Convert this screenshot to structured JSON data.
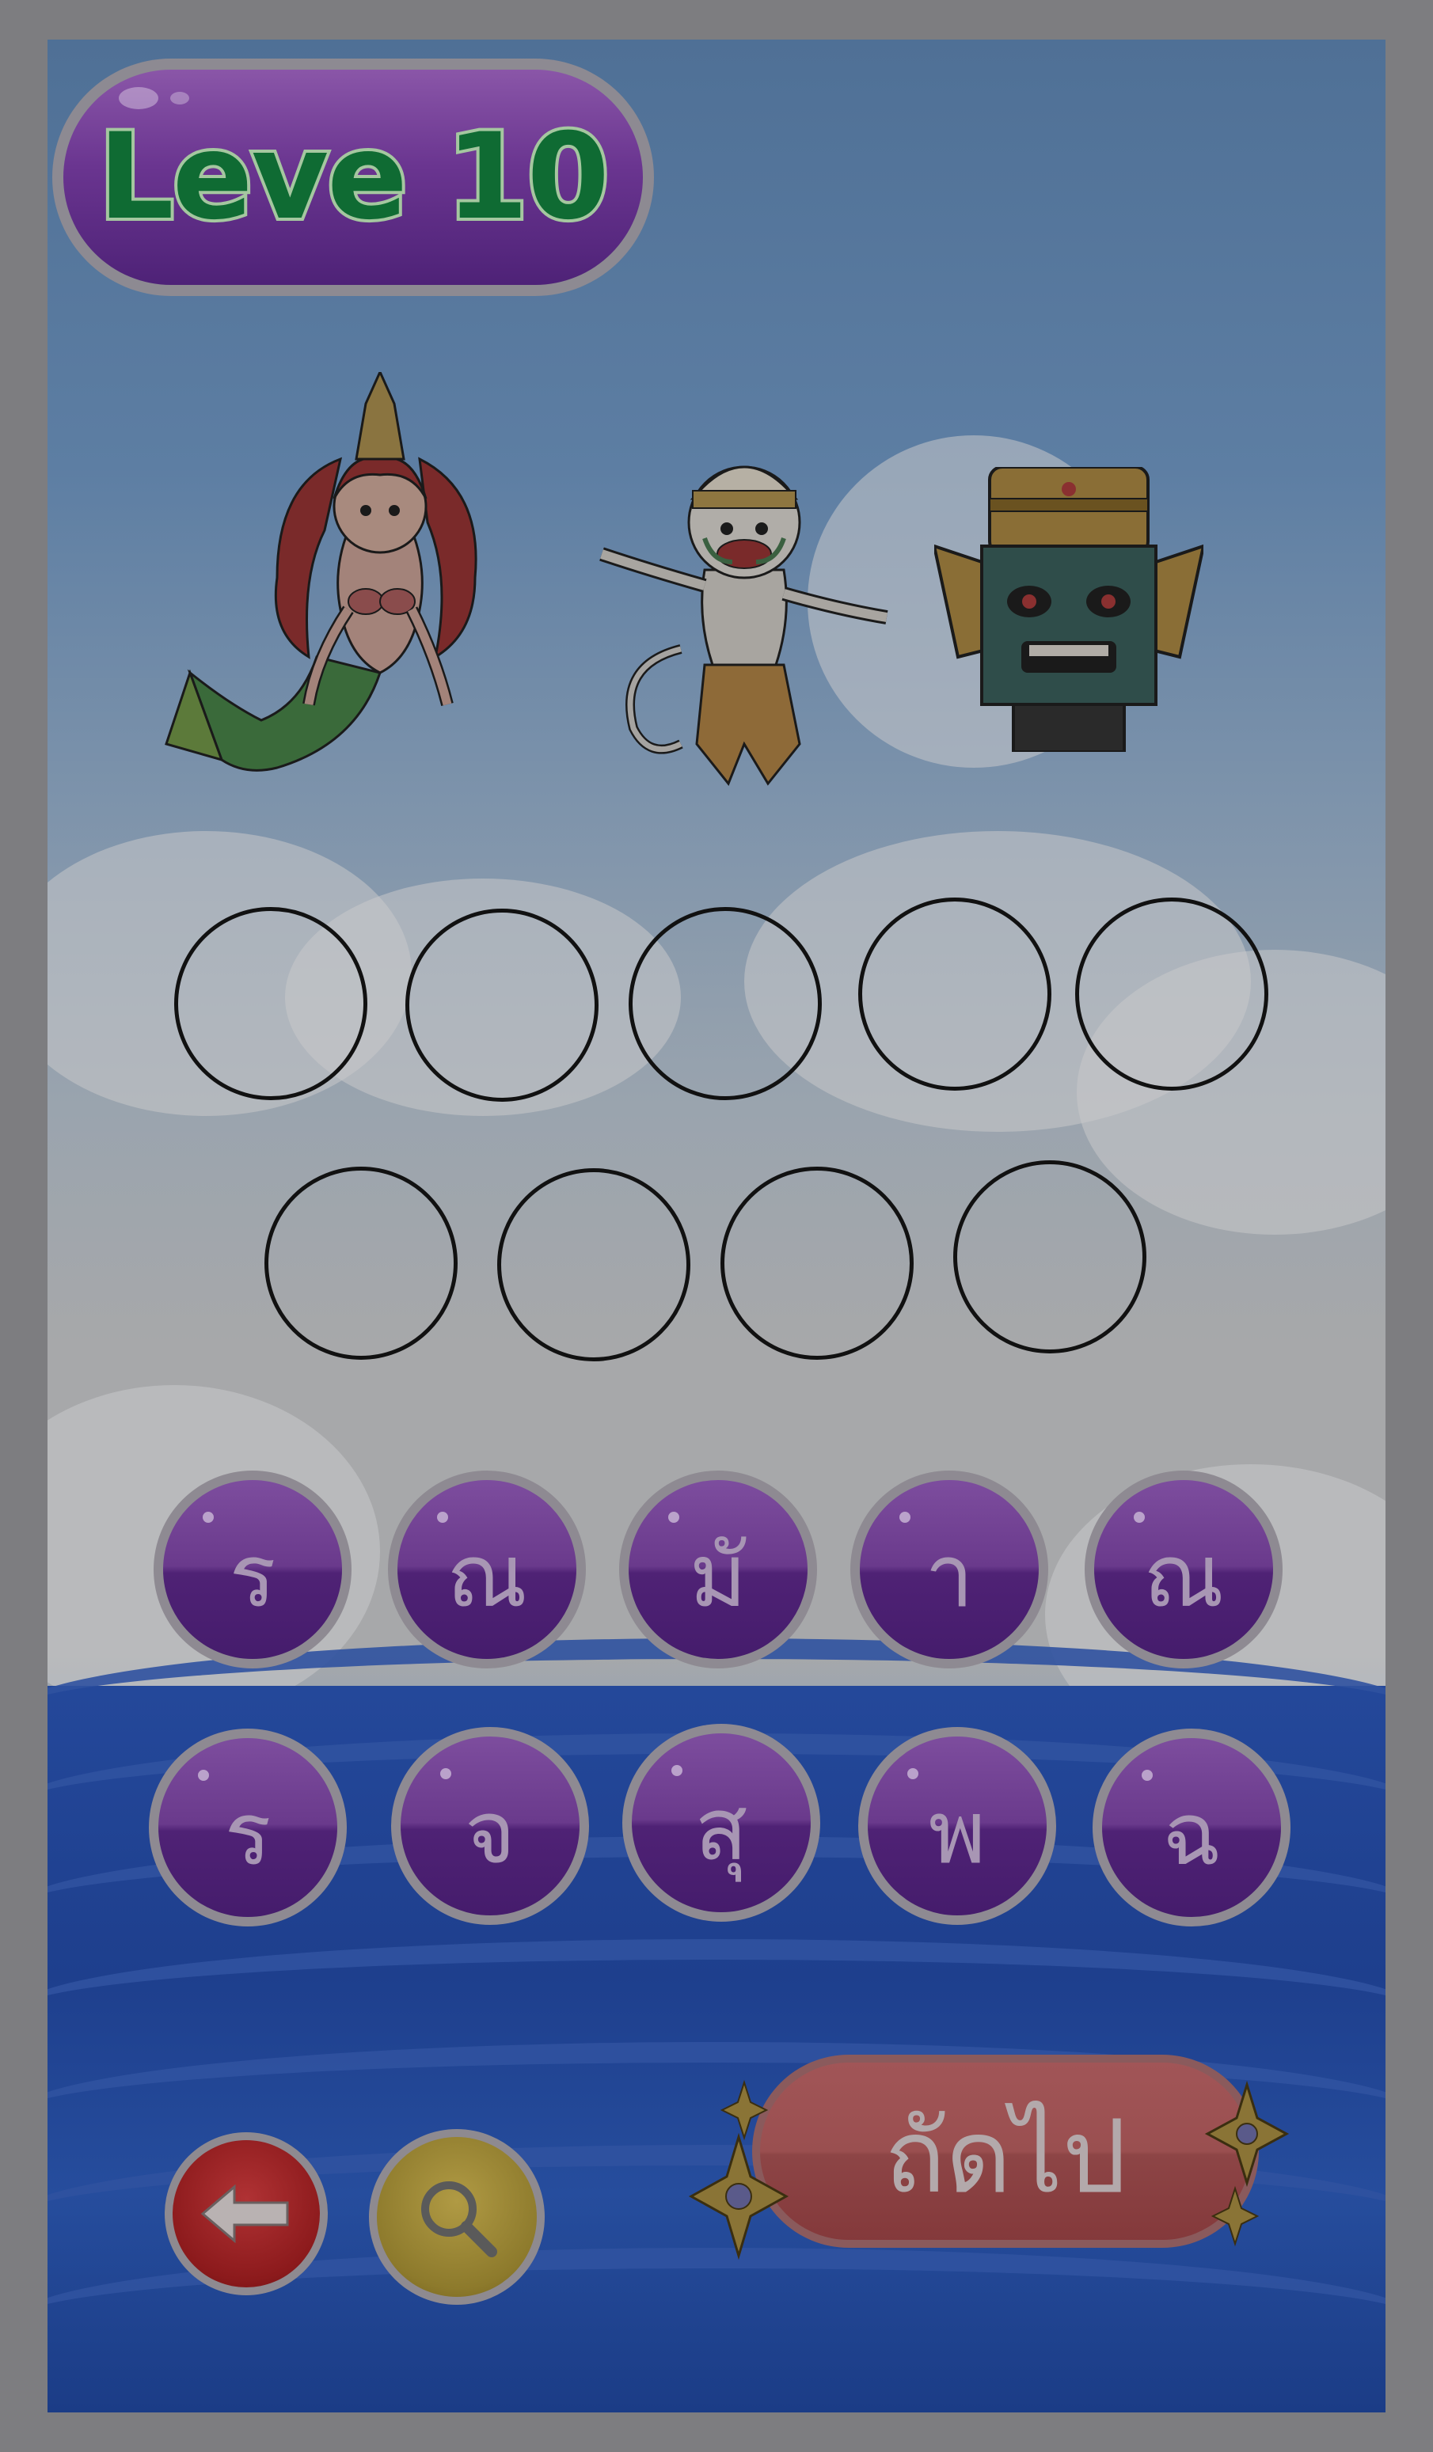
{
  "level": {
    "label": "Leve 10"
  },
  "characters": [
    {
      "name": "mermaid-character",
      "kind": "mermaid"
    },
    {
      "name": "hanuman-character",
      "kind": "monkey-warrior"
    },
    {
      "name": "giant-mask-character",
      "kind": "yak-giant-mask"
    }
  ],
  "answer_slots": {
    "row1": 5,
    "row2": 4,
    "filled": []
  },
  "letter_tiles": {
    "row1": [
      "ร",
      "ณ",
      "มั",
      "า",
      "ณ"
    ],
    "row2": [
      "ร",
      "จ",
      "สุ",
      "พ",
      "ฉ"
    ]
  },
  "controls": {
    "back_icon": "arrow-left-icon",
    "hint_icon": "magnifier-icon",
    "next_label": "ถัดไป"
  },
  "colors": {
    "tile_purple": "#6a3a8c",
    "level_text_green": "#0f6b33",
    "back_red": "#8c1a1c",
    "hint_yellow": "#8d7a2c",
    "next_red": "#9a4f50",
    "sea_blue": "#24489a"
  }
}
